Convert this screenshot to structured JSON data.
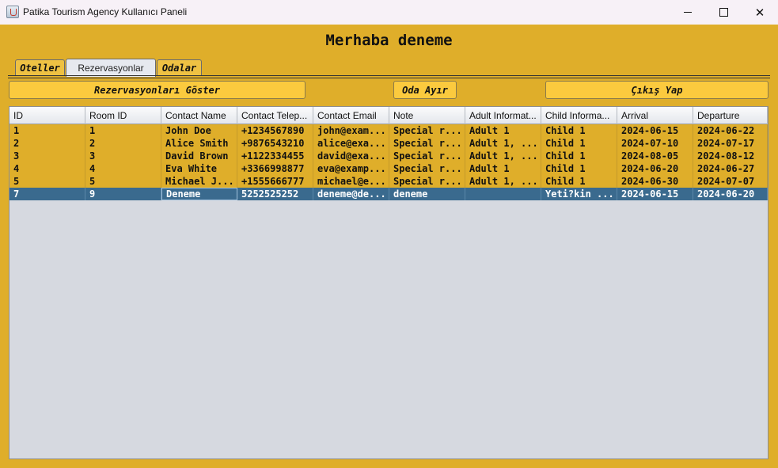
{
  "window": {
    "title": "Patika Tourism Agency Kullanıcı Paneli",
    "minimize_glyph": "",
    "maximize_glyph": "",
    "close_glyph": "✕"
  },
  "greeting": "Merhaba deneme",
  "tabs": [
    {
      "label": "Oteller",
      "active": false
    },
    {
      "label": "Rezervasyonlar",
      "active": true
    },
    {
      "label": "Odalar",
      "active": false
    }
  ],
  "toolbar": {
    "show_reservations": "Rezervasyonları Göster",
    "allocate_room": "Oda Ayır",
    "logout": "Çıkış Yap"
  },
  "table": {
    "columns": [
      "ID",
      "Room ID",
      "Contact Name",
      "Contact Telep...",
      "Contact Email",
      "Note",
      "Adult Informat...",
      "Child Informa...",
      "Arrival",
      "Departure"
    ],
    "rows": [
      [
        "1",
        "1",
        "John Doe",
        "+1234567890",
        "john@exam...",
        "Special r...",
        "Adult 1",
        "Child 1",
        "2024-06-15",
        "2024-06-22"
      ],
      [
        "2",
        "2",
        "Alice Smith",
        "+9876543210",
        "alice@exa...",
        "Special r...",
        "Adult 1, ...",
        "Child 1",
        "2024-07-10",
        "2024-07-17"
      ],
      [
        "3",
        "3",
        "David Brown",
        "+1122334455",
        "david@exa...",
        "Special r...",
        "Adult 1, ...",
        "Child 1",
        "2024-08-05",
        "2024-08-12"
      ],
      [
        "4",
        "4",
        "Eva White",
        "+3366998877",
        "eva@examp...",
        "Special r...",
        "Adult 1",
        "Child 1",
        "2024-06-20",
        "2024-06-27"
      ],
      [
        "5",
        "5",
        "Michael J...",
        "+1555666777",
        "michael@e...",
        "Special r...",
        "Adult 1, ...",
        "Child 1",
        "2024-06-30",
        "2024-07-07"
      ],
      [
        "7",
        "9",
        "Deneme",
        "5252525252",
        "deneme@de...",
        "deneme",
        "",
        "Yeti?kin ...",
        "2024-06-15",
        "2024-06-20"
      ]
    ],
    "selected_row": 5
  },
  "colors": {
    "background": "#dfae2a",
    "button": "#fbca3e",
    "selection": "#3a6a8e",
    "table_empty": "#d6d9e0"
  }
}
